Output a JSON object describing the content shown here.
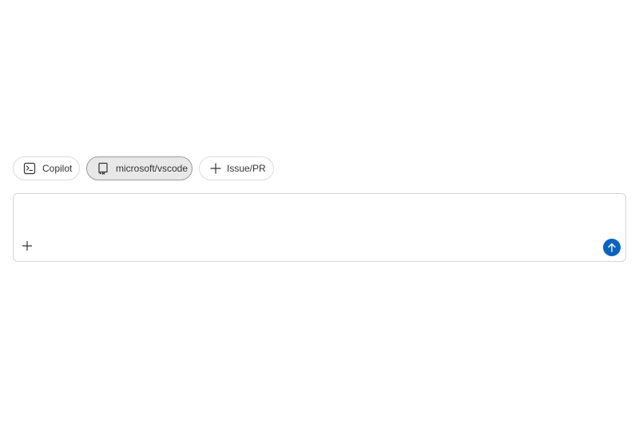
{
  "chips": [
    {
      "label": "Copilot",
      "icon": "terminal-icon",
      "selected": false
    },
    {
      "label": "microsoft/vscode",
      "icon": "repo-icon",
      "selected": true
    },
    {
      "label": "Issue/PR",
      "icon": "plus-icon",
      "selected": false
    }
  ],
  "composer": {
    "value": "",
    "attach_icon": "plus-icon",
    "send_icon": "arrow-up-icon"
  },
  "colors": {
    "accent": "#0b63bf",
    "chip_border": "#dcdcdc",
    "chip_selected_bg": "#e8e8e8",
    "text": "#333333"
  }
}
